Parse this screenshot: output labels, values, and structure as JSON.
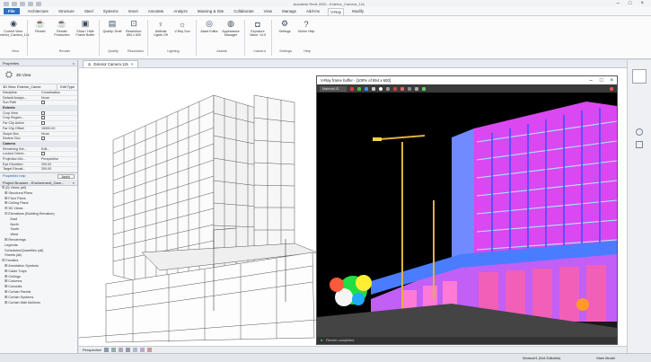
{
  "window": {
    "title": "Autodesk Revit 2020 - Exterior_Camera_12s"
  },
  "menu": {
    "file": "File",
    "tabs": [
      "Architecture",
      "Structure",
      "Steel",
      "Systems",
      "Insert",
      "Annotate",
      "Analyze",
      "Massing & Site",
      "Collaborate",
      "View",
      "Manage",
      "Add-Ins",
      "V-Ray",
      "Modify"
    ],
    "active": "V-Ray"
  },
  "ribbon": {
    "buttons": [
      {
        "label": "Current View: Exterior_Camera_12s",
        "icon": "camera-icon"
      },
      {
        "label": "Render",
        "icon": "teapot-icon"
      },
      {
        "label": "Render Production",
        "icon": "teapot-icon"
      },
      {
        "label": "Show / Hide Frame Buffer",
        "icon": "frame-buffer-icon"
      },
      {
        "label": "Quality: Draft",
        "icon": "quality-icon"
      },
      {
        "label": "Resolution: 854 x 600",
        "icon": "resolution-icon"
      },
      {
        "label": "Artificial Lights Off",
        "icon": "light-bulb-icon"
      },
      {
        "label": "V-Ray Sun",
        "icon": "sun-icon"
      },
      {
        "label": "Asset Editor",
        "icon": "asset-editor-icon"
      },
      {
        "label": "Appearance Manager",
        "icon": "appearance-icon"
      },
      {
        "label": "Exposure Value: 14.0",
        "icon": "exposure-icon"
      },
      {
        "label": "Settings",
        "icon": "gear-icon"
      },
      {
        "label": "Online Help",
        "icon": "help-icon"
      }
    ],
    "groups": [
      "View",
      "Render",
      "Quality",
      "Resolution",
      "Lighting",
      "Assets",
      "Camera",
      "Settings",
      "Help"
    ]
  },
  "properties": {
    "header": "Properties",
    "type_label": "3D View",
    "selector": "3D View: Exterior_Camer",
    "edit_type": "Edit Type",
    "rows_top": [
      {
        "k": "Discipline",
        "v": "Coordination"
      },
      {
        "k": "Default Analys...",
        "v": "None"
      },
      {
        "k": "Sun Path",
        "v": ""
      }
    ],
    "extents_title": "Extents",
    "rows_extents": [
      {
        "k": "Crop View",
        "v": ""
      },
      {
        "k": "Crop Region...",
        "v": ""
      },
      {
        "k": "Far Clip Active",
        "v": ""
      },
      {
        "k": "Far Clip Offset",
        "v": "15000.00"
      },
      {
        "k": "Scope Box",
        "v": "None"
      },
      {
        "k": "Section Box",
        "v": ""
      }
    ],
    "camera_title": "Camera",
    "rows_camera": [
      {
        "k": "Rendering Set...",
        "v": "Edit..."
      },
      {
        "k": "Locked Orient...",
        "v": ""
      },
      {
        "k": "Projection Mo...",
        "v": "Perspective"
      },
      {
        "k": "Eye Elevation",
        "v": "200.00"
      },
      {
        "k": "Target Elevati...",
        "v": "200.00"
      }
    ],
    "help": "Properties help",
    "apply": "Apply"
  },
  "browser": {
    "header": "Project Browser - Environment_Cam...",
    "items": [
      "⊟ [0] Views (all)",
      "   ⊞ Structural Plans",
      "   ⊞ Floor Plans",
      "   ⊞ Ceiling Plans",
      "   ⊟ 3D Views",
      "   ⊟ Elevations (Building Elevation)",
      "         East",
      "         North",
      "         South",
      "         West",
      "   ⊞ Renderings",
      "   Legends",
      "   Schedules/Quantities (all)",
      "   Sheets (all)",
      "⊟ Families",
      "   ⊞ Annotation Symbols",
      "   ⊞ Cable Trays",
      "   ⊞ Ceilings",
      "   ⊞ Columns",
      "   ⊞ Conduits",
      "   ⊞ Curtain Panels",
      "   ⊞ Curtain Systems",
      "   ⊞ Curtain Wall Mullions"
    ]
  },
  "viewport": {
    "tab": "Exterior Camera 12s",
    "view_mode": "Perspective"
  },
  "vfb": {
    "title": "V-Ray frame buffer - [100% of 854 x 600]",
    "channel": "Material ID",
    "status": "Render completed"
  },
  "taskbar": {
    "items": [
      "Workset1 (Not Editable)",
      "Main Model"
    ]
  }
}
